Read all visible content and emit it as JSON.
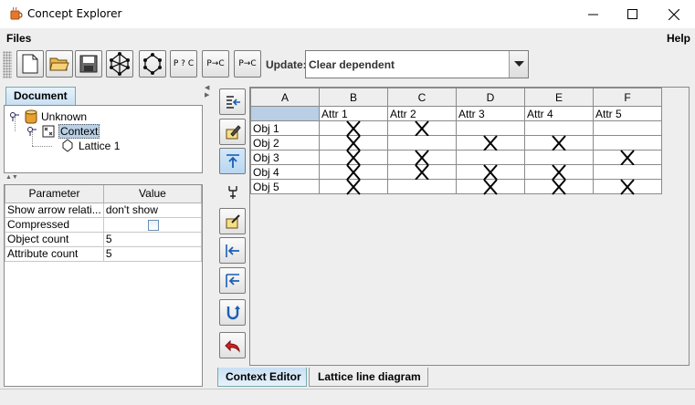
{
  "window": {
    "title": "Concept Explorer",
    "icon": "java-cup-icon",
    "controls": [
      "minimize-icon",
      "maximize-icon",
      "close-icon"
    ]
  },
  "menu": {
    "files": "Files",
    "help": "Help"
  },
  "toolbar": {
    "buttons": [
      {
        "name": "new-document-icon"
      },
      {
        "name": "open-folder-icon"
      },
      {
        "name": "save-disk-icon"
      },
      {
        "name": "lattice-icon"
      },
      {
        "name": "lattice-outline-icon"
      },
      {
        "label": "P ? C"
      },
      {
        "label": "P→C"
      },
      {
        "label": "P→C"
      }
    ],
    "update_label": "Update:",
    "update_value": "Clear dependent"
  },
  "document": {
    "tab_label": "Document",
    "tree": [
      {
        "label": "Unknown",
        "icon": "database-icon"
      },
      {
        "label": "Context",
        "icon": "context-icon",
        "selected": true
      },
      {
        "label": "Lattice 1",
        "icon": "lattice-icon"
      }
    ]
  },
  "properties": {
    "headers": [
      "Parameter",
      "Value"
    ],
    "rows": [
      {
        "param": "Show arrow relati...",
        "value": "don't show"
      },
      {
        "param": "Compressed",
        "value": "",
        "checkbox": true,
        "checked": false
      },
      {
        "param": "Object count",
        "value": "5"
      },
      {
        "param": "Attribute count",
        "value": "5"
      }
    ]
  },
  "side_toolbar": [
    "insert-column-icon",
    "edit-icon",
    "move-up-icon",
    "split-icon",
    "clear-icon",
    "move-left-icon",
    "move-top-left-icon",
    "undo-icon",
    "revert-icon"
  ],
  "context": {
    "column_letters": [
      "A",
      "B",
      "C",
      "D",
      "E",
      "F"
    ],
    "attributes": [
      "Attr 1",
      "Attr 2",
      "Attr 3",
      "Attr 4",
      "Attr 5"
    ],
    "objects": [
      "Obj 1",
      "Obj 2",
      "Obj 3",
      "Obj 4",
      "Obj 5"
    ],
    "relation": [
      [
        1,
        1,
        0,
        0,
        0
      ],
      [
        1,
        0,
        1,
        1,
        0
      ],
      [
        1,
        1,
        0,
        0,
        1
      ],
      [
        1,
        1,
        1,
        1,
        0
      ],
      [
        1,
        0,
        1,
        1,
        1
      ]
    ]
  },
  "bottom_tabs": [
    "Context Editor",
    "Lattice line diagram"
  ]
}
